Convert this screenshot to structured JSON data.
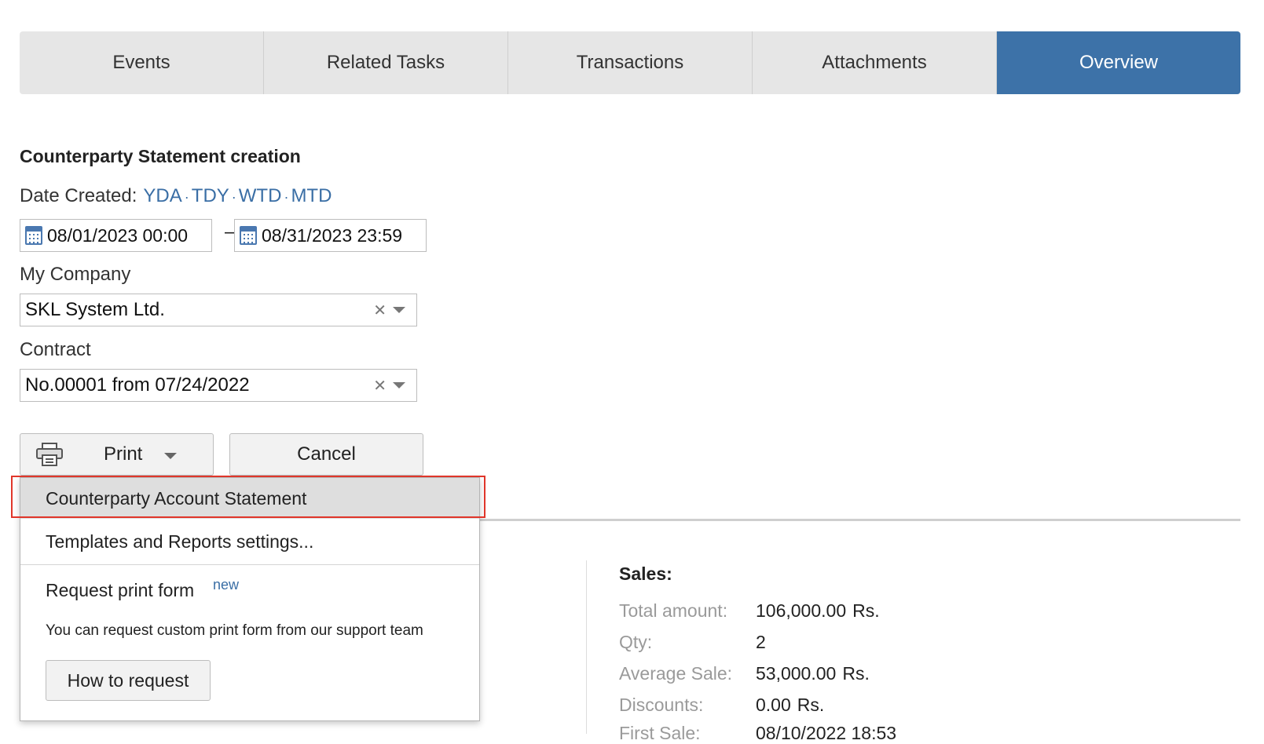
{
  "tabs": [
    {
      "label": "Events"
    },
    {
      "label": "Related Tasks"
    },
    {
      "label": "Transactions"
    },
    {
      "label": "Attachments"
    },
    {
      "label": "Overview"
    }
  ],
  "form": {
    "title": "Counterparty Statement creation",
    "date_label": "Date Created:",
    "quick_links": [
      "YDA",
      "TDY",
      "WTD",
      "MTD"
    ],
    "date_from": "08/01/2023 00:00",
    "date_to": "08/31/2023 23:59",
    "date_separator": "–",
    "company_label": "My Company",
    "company_value": "SKL System Ltd.",
    "contract_label": "Contract",
    "contract_value": "No.00001 from 07/24/2022"
  },
  "buttons": {
    "print": "Print",
    "cancel": "Cancel"
  },
  "print_menu": {
    "items": [
      "Counterparty Account Statement",
      "Templates and Reports settings..."
    ],
    "request_title": "Request print form",
    "request_badge": "new",
    "request_description": "You can request custom print form from our support team",
    "how_to_request": "How to request"
  },
  "sales": {
    "title": "Sales:",
    "rows": [
      {
        "label": "Total amount:",
        "value": "106,000.00",
        "unit": "Rs."
      },
      {
        "label": "Qty:",
        "value": "2",
        "unit": ""
      },
      {
        "label": "Average Sale:",
        "value": "53,000.00",
        "unit": "Rs."
      },
      {
        "label": "Discounts:",
        "value": "0.00",
        "unit": "Rs."
      },
      {
        "label": "First Sale:",
        "value": "08/10/2022 18:53",
        "unit": ""
      }
    ]
  },
  "colors": {
    "active_tab": "#3d72a8",
    "link": "#3a6ea5",
    "highlight_border": "#e0362a"
  }
}
